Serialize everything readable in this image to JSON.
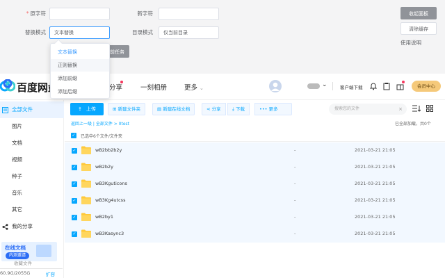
{
  "tool": {
    "original_label": "原字符",
    "new_label": "新字符",
    "mode_label": "替换模式",
    "mode_value": "文本替换",
    "dir_mode_label": "目录模式",
    "dir_mode_value": "仅当前目录",
    "collapse_btn": "收起面板",
    "clear_cache_btn": "清除缓存",
    "help_link": "使用说明",
    "hidden_btn_label": "执行任务",
    "hidden_btn_visible_part": "前任务",
    "mode_options": [
      "文本替换",
      "正则替换",
      "添加前缀",
      "添加后缀"
    ]
  },
  "header": {
    "logo": "百度网盘",
    "nav": [
      "分享",
      "一刻相册",
      "更多"
    ],
    "client_download": "客户端下载",
    "vip_center": "会员中心"
  },
  "sidebar": {
    "items": [
      {
        "label": "全部文件",
        "active": true
      },
      {
        "label": "图片"
      },
      {
        "label": "文档"
      },
      {
        "label": "视频"
      },
      {
        "label": "种子"
      },
      {
        "label": "音乐"
      },
      {
        "label": "其它"
      },
      {
        "label": "我的分享"
      }
    ],
    "ad_text1": "在线文档",
    "ad_text2": "内测邀请",
    "recycle": "收藏文件",
    "quota": "60.9G/2055G",
    "expand": "扩容"
  },
  "toolbar": {
    "upload": "上传",
    "new_folder": "新建文件夹",
    "new_doc": "新建在线文档",
    "share": "分享",
    "download": "下载",
    "more": "更多",
    "search_placeholder": "搜索您的文件"
  },
  "breadcrumb": "返回上一级 | 全部文件  >  0test",
  "load_status": "已全部加载，共0个",
  "selected_info": "已选中6个文件/文件夹",
  "files": [
    {
      "name": "wB2bb2b2y",
      "size": "-",
      "time": "2021-03-21 21:05"
    },
    {
      "name": "wB2b2y",
      "size": "-",
      "time": "2021-03-21 21:05"
    },
    {
      "name": "wB3Kguticons",
      "size": "-",
      "time": "2021-03-21 21:05"
    },
    {
      "name": "wB3Kg4utcss",
      "size": "-",
      "time": "2021-03-21 21:05"
    },
    {
      "name": "wB2by1",
      "size": "-",
      "time": "2021-03-21 21:05"
    },
    {
      "name": "wB3Kasync3",
      "size": "-",
      "time": "2021-03-21 21:05"
    }
  ],
  "colors": {
    "accent": "#06a7ff",
    "panel_bg": "#f4f4f5",
    "selected_row": "#f2f8ff",
    "vip": "#f5c97a"
  }
}
